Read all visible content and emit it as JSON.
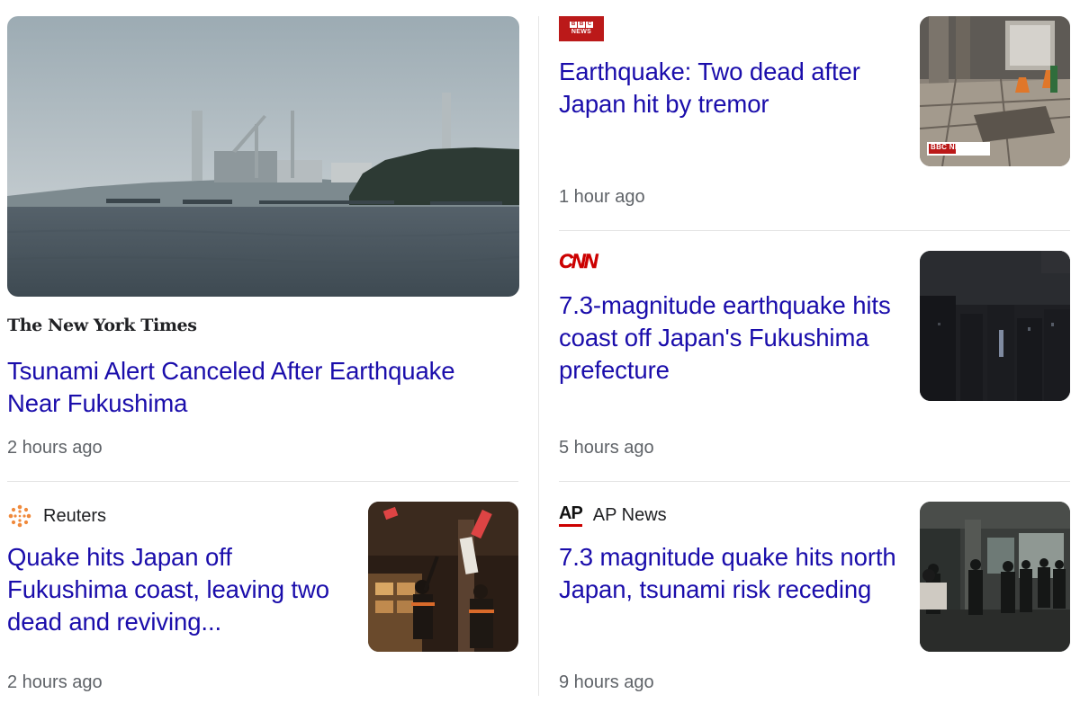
{
  "stories": [
    {
      "source": "The New York Times",
      "headline": "Tsunami Alert Canceled After Earthquake Near Fukushima",
      "time": "2 hours ago"
    },
    {
      "source": "Reuters",
      "headline": "Quake hits Japan off Fukushima coast, leaving two dead and reviving...",
      "time": "2 hours ago"
    },
    {
      "source": "BBC News",
      "headline": "Earthquake: Two dead after Japan hit by tremor",
      "time": "1 hour ago",
      "thumbnail_overlay": "BBC NEWS"
    },
    {
      "source": "CNN",
      "headline": "7.3-magnitude earthquake hits coast off Japan's Fukushima prefecture",
      "time": "5 hours ago"
    },
    {
      "source": "AP News",
      "headline": "7.3 magnitude quake hits north Japan, tsunami risk receding",
      "time": "9 hours ago"
    }
  ],
  "logos": {
    "nyt": "The New York Times",
    "bbc_boxes": [
      "B",
      "B",
      "C"
    ],
    "bbc_word": "NEWS",
    "cnn": "CNN",
    "ap": "AP"
  },
  "colors": {
    "headline": "#1a0dab",
    "time": "#5f6368",
    "divider": "#e3e3e3"
  }
}
